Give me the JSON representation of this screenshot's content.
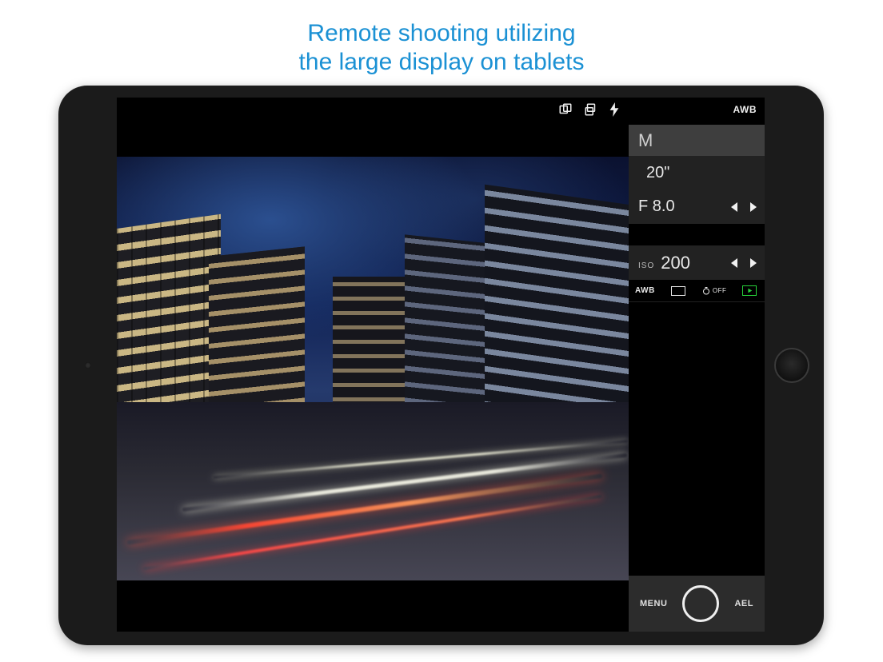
{
  "headline": {
    "line1": "Remote shooting utilizing",
    "line2": "the large display on tablets"
  },
  "topbar": {
    "wb_badge": "AWB"
  },
  "settings": {
    "mode": "M",
    "shutter": "20\"",
    "aperture": "F 8.0",
    "iso_label": "ISO",
    "iso_value": "200",
    "row_icons": {
      "awb": "AWB",
      "timer_off": "OFF"
    }
  },
  "bottombar": {
    "menu": "MENU",
    "ael": "AEL"
  },
  "colors": {
    "accent_blue": "#1b91d4",
    "play_green": "#27d13a"
  }
}
